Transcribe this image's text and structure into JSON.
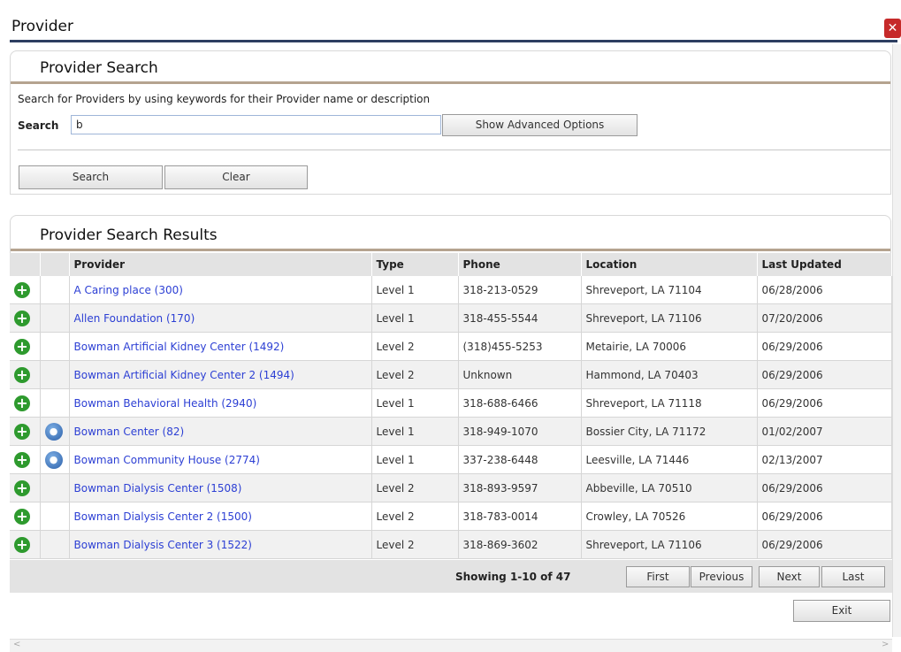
{
  "window": {
    "title": "Provider",
    "close_glyph": "✕"
  },
  "search_panel": {
    "title": "Provider Search",
    "description": "Search for Providers by using keywords for their Provider name or description",
    "search_label": "Search",
    "search_value": "b",
    "advanced_button": "Show Advanced Options",
    "search_button": "Search",
    "clear_button": "Clear"
  },
  "results_panel": {
    "title": "Provider Search Results",
    "columns": [
      "Provider",
      "Type",
      "Phone",
      "Location",
      "Last Updated"
    ],
    "rows": [
      {
        "provider": "A Caring place (300)",
        "type": "Level 1",
        "phone": "318-213-0529",
        "location": "Shreveport, LA  71104",
        "updated": "06/28/2006",
        "person": false
      },
      {
        "provider": "Allen Foundation (170)",
        "type": "Level 1",
        "phone": "318-455-5544",
        "location": "Shreveport, LA  71106",
        "updated": "07/20/2006",
        "person": false
      },
      {
        "provider": "Bowman Artificial Kidney Center (1492)",
        "type": "Level 2",
        "phone": "(318)455-5253",
        "location": "Metairie, LA  70006",
        "updated": "06/29/2006",
        "person": false
      },
      {
        "provider": "Bowman Artificial Kidney Center 2 (1494)",
        "type": "Level 2",
        "phone": "Unknown",
        "location": "Hammond, LA  70403",
        "updated": "06/29/2006",
        "person": false
      },
      {
        "provider": "Bowman Behavioral Health (2940)",
        "type": "Level 1",
        "phone": "318-688-6466",
        "location": "Shreveport, LA  71118",
        "updated": "06/29/2006",
        "person": false
      },
      {
        "provider": "Bowman Center (82)",
        "type": "Level 1",
        "phone": "318-949-1070",
        "location": "Bossier City, LA  71172",
        "updated": "01/02/2007",
        "person": true
      },
      {
        "provider": "Bowman Community House (2774)",
        "type": "Level 1",
        "phone": "337-238-6448",
        "location": "Leesville, LA  71446",
        "updated": "02/13/2007",
        "person": true
      },
      {
        "provider": "Bowman Dialysis Center (1508)",
        "type": "Level 2",
        "phone": "318-893-9597",
        "location": "Abbeville, LA  70510",
        "updated": "06/29/2006",
        "person": false
      },
      {
        "provider": "Bowman Dialysis Center 2 (1500)",
        "type": "Level 2",
        "phone": "318-783-0014",
        "location": "Crowley, LA  70526",
        "updated": "06/29/2006",
        "person": false
      },
      {
        "provider": "Bowman Dialysis Center 3 (1522)",
        "type": "Level 2",
        "phone": "318-869-3602",
        "location": "Shreveport, LA  71106",
        "updated": "06/29/2006",
        "person": false
      }
    ],
    "pager": {
      "status": "Showing 1-10 of 47",
      "first": "First",
      "previous": "Previous",
      "next": "Next",
      "last": "Last"
    }
  },
  "exit_button": "Exit",
  "icons": {
    "add": "add-icon",
    "person": "person-icon",
    "close": "close-icon"
  },
  "colors": {
    "title_rule": "#2d3e61",
    "panel_rule": "#b5a38f",
    "link": "#2c3fd4",
    "add_icon": "#2e9a2e",
    "close": "#c62a2a"
  }
}
